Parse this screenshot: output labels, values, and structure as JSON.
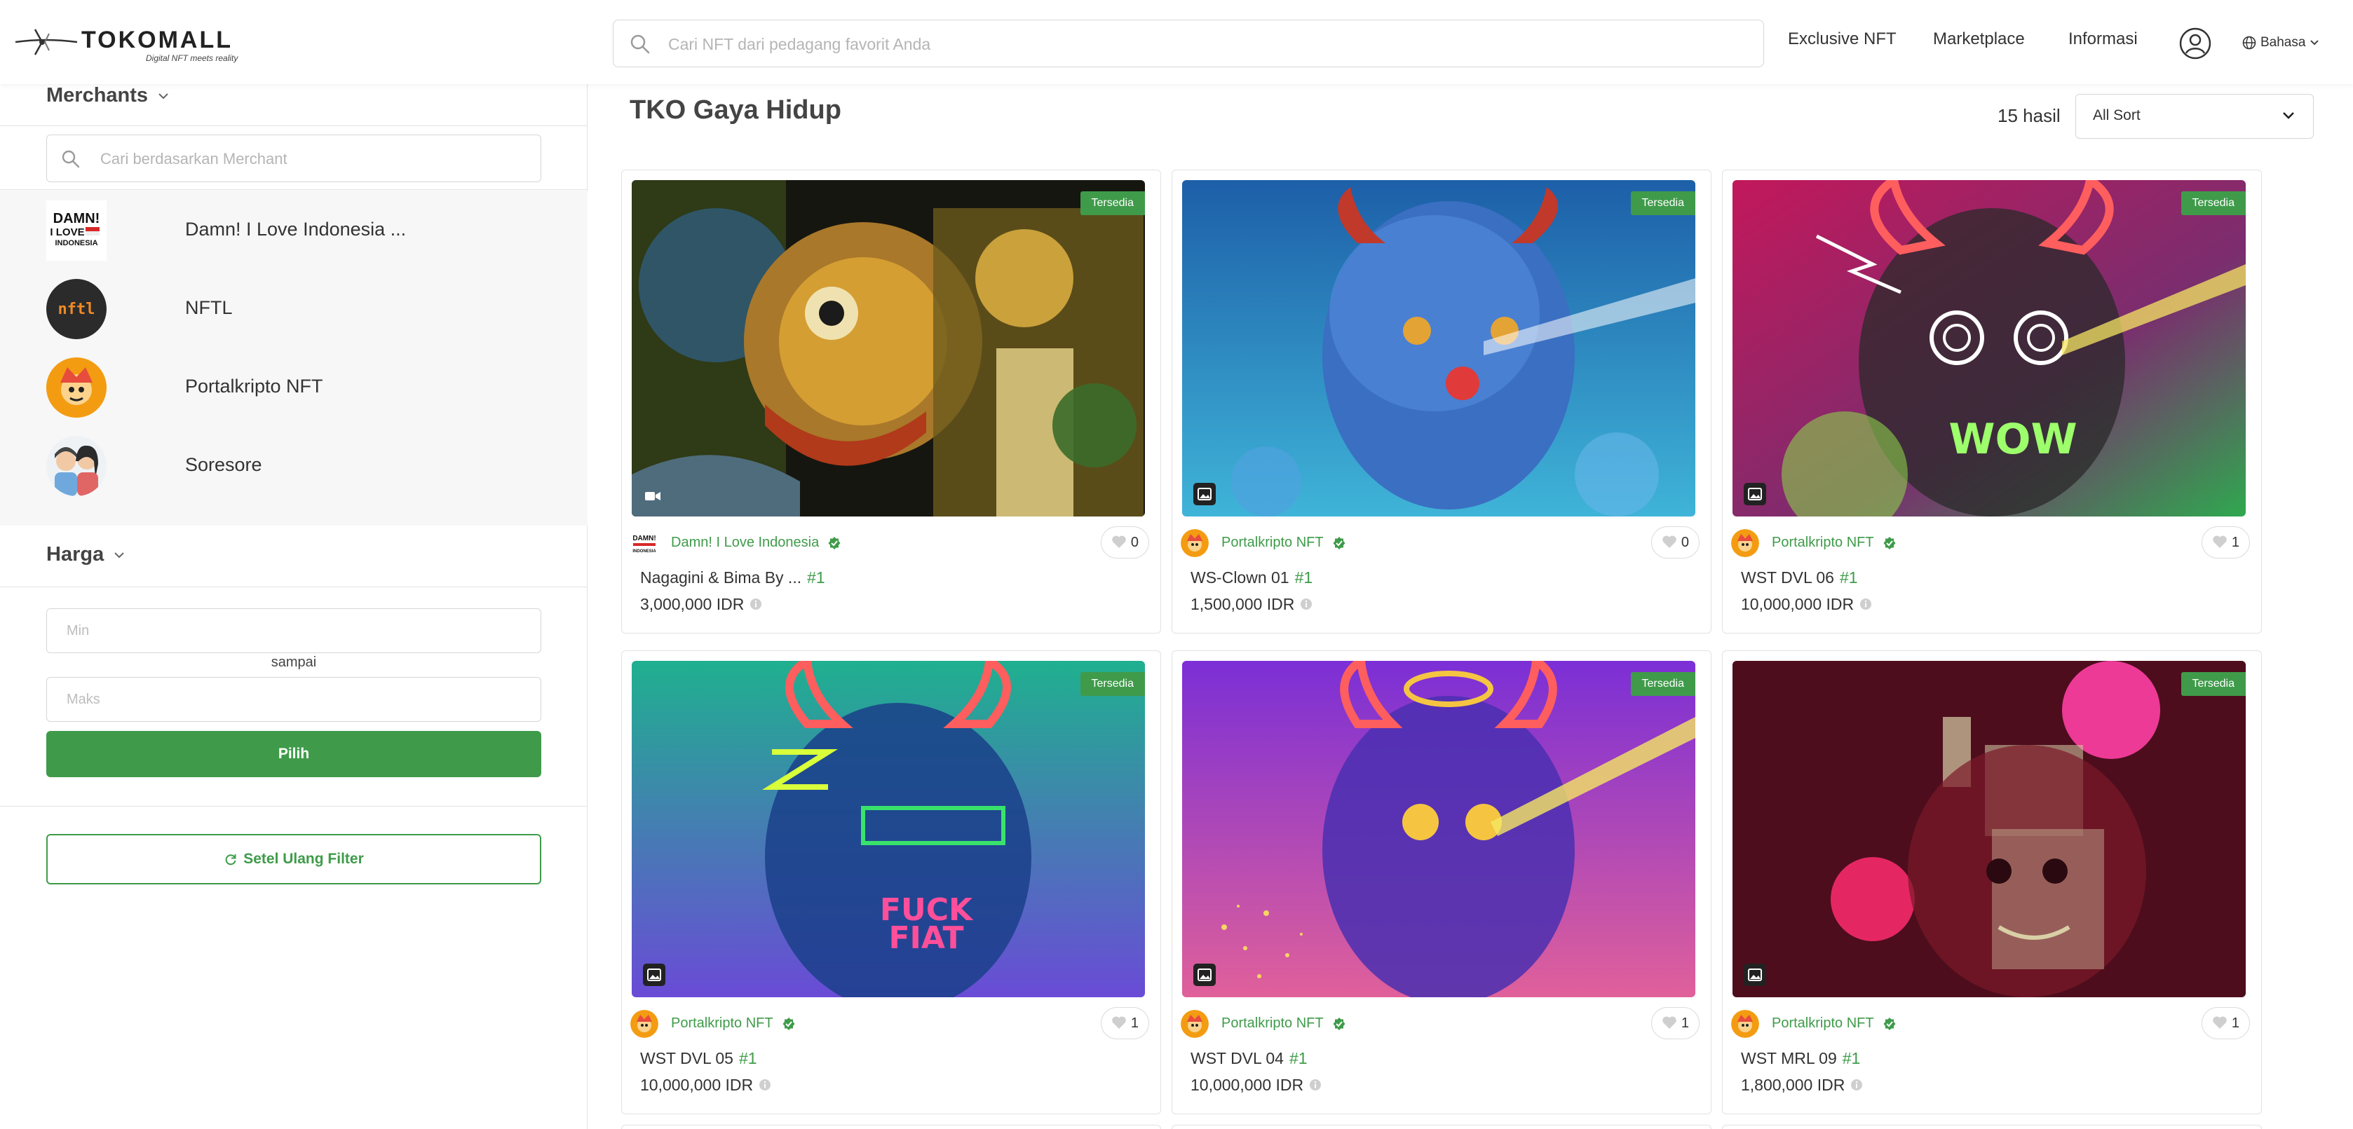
{
  "header": {
    "brand": "TOKOMALL",
    "tagline": "Digital NFT meets reality",
    "search_placeholder": "Cari NFT dari pedagang favorit Anda",
    "nav": [
      "Exclusive NFT",
      "Marketplace",
      "Informasi"
    ],
    "language": "Bahasa"
  },
  "sidebar": {
    "merchants_title": "Merchants",
    "merchant_search_placeholder": "Cari berdasarkan Merchant",
    "merchants": [
      {
        "name": "Damn! I Love Indonesia ...",
        "avatar": "damn-i-love-indonesia-logo"
      },
      {
        "name": "NFTL",
        "avatar": "nftl-logo"
      },
      {
        "name": "Portalkripto NFT",
        "avatar": "portalkripto-logo"
      },
      {
        "name": "Soresore",
        "avatar": "soresore-logo"
      }
    ],
    "price_title": "Harga",
    "min_placeholder": "Min",
    "between_label": "sampai",
    "max_placeholder": "Maks",
    "apply_label": "Pilih",
    "reset_label": "Setel Ulang Filter"
  },
  "main": {
    "title": "TKO Gaya Hidup",
    "result_count": "15 hasil",
    "sort_value": "All Sort",
    "cards": [
      {
        "badge": "Tersedia",
        "merchant": "Damn! I Love Indonesia",
        "likes": "0",
        "name": "Nagagini & Bima By ...",
        "edition": "#1",
        "price": "3,000,000 IDR",
        "media": "video-icon"
      },
      {
        "badge": "Tersedia",
        "merchant": "Portalkripto NFT",
        "likes": "0",
        "name": "WS-Clown 01",
        "edition": "#1",
        "price": "1,500,000 IDR",
        "media": "image-icon"
      },
      {
        "badge": "Tersedia",
        "merchant": "Portalkripto NFT",
        "likes": "1",
        "name": "WST DVL 06",
        "edition": "#1",
        "price": "10,000,000 IDR",
        "media": "image-icon"
      },
      {
        "badge": "Tersedia",
        "merchant": "Portalkripto NFT",
        "likes": "1",
        "name": "WST DVL 05",
        "edition": "#1",
        "price": "10,000,000 IDR",
        "media": "image-icon"
      },
      {
        "badge": "Tersedia",
        "merchant": "Portalkripto NFT",
        "likes": "1",
        "name": "WST DVL 04",
        "edition": "#1",
        "price": "10,000,000 IDR",
        "media": "image-icon"
      },
      {
        "badge": "Tersedia",
        "merchant": "Portalkripto NFT",
        "likes": "1",
        "name": "WST MRL 09",
        "edition": "#1",
        "price": "1,800,000 IDR",
        "media": "image-icon"
      }
    ]
  },
  "colors": {
    "accent": "#3f9b4a",
    "text": "#333333",
    "border": "#e2e2e2"
  }
}
